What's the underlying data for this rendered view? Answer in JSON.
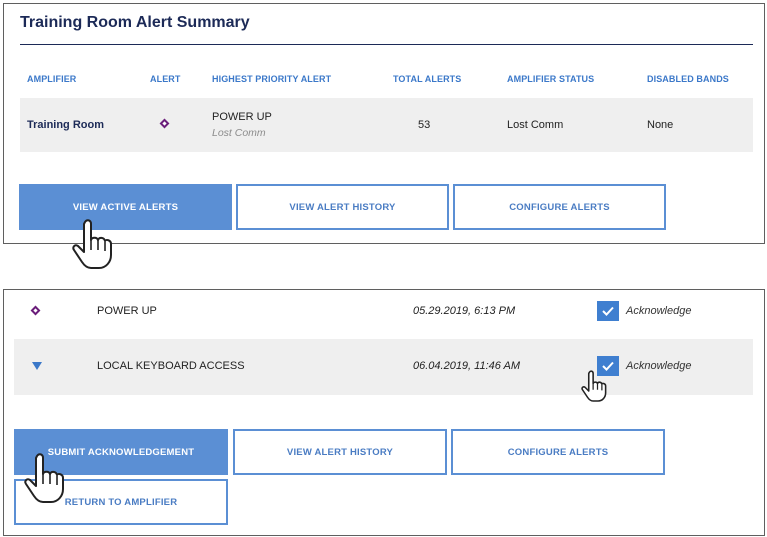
{
  "summary": {
    "title": "Training Room Alert Summary",
    "columns": [
      "AMPLIFIER",
      "ALERT",
      "HIGHEST PRIORITY ALERT",
      "TOTAL ALERTS",
      "AMPLIFIER STATUS",
      "DISABLED BANDS"
    ],
    "row": {
      "amplifier": "Training Room",
      "alert_icon": "diamond-icon",
      "highest_alert": "POWER UP",
      "highest_alert_sub": "Lost Comm",
      "total_alerts": "53",
      "status": "Lost Comm",
      "disabled_bands": "None"
    },
    "buttons": {
      "view_active": "VIEW ACTIVE ALERTS",
      "view_history": "VIEW ALERT HISTORY",
      "configure": "CONFIGURE ALERTS"
    }
  },
  "alerts": {
    "items": [
      {
        "icon": "diamond-icon",
        "name": "POWER UP",
        "time": "05.29.2019, 6:13 PM",
        "ack_label": "Acknowledge",
        "checked": true
      },
      {
        "icon": "triangle-down-icon",
        "name": "LOCAL KEYBOARD ACCESS",
        "time": "06.04.2019, 11:46 AM",
        "ack_label": "Acknowledge",
        "checked": true
      }
    ],
    "buttons": {
      "submit": "SUBMIT ACKNOWLEDGEMENT",
      "view_history": "VIEW ALERT HISTORY",
      "configure": "CONFIGURE ALERTS",
      "return": "RETURN TO AMPLIFIER"
    }
  },
  "colors": {
    "accent": "#5b8fd4",
    "title": "#1c2a57",
    "alert_purple": "#6a1d7a",
    "row_band": "#efefef"
  }
}
